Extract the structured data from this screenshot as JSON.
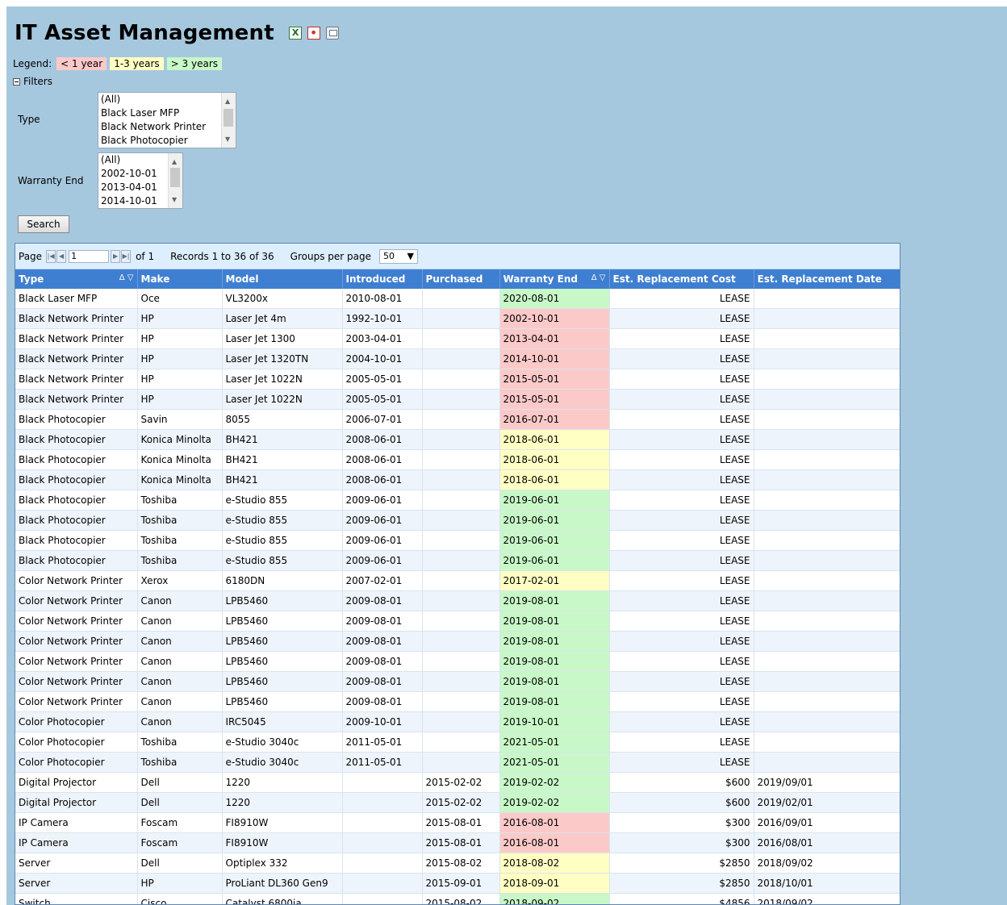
{
  "page": {
    "title": "IT Asset Management"
  },
  "legend": {
    "label": "Legend:",
    "items": [
      {
        "label": "< 1 year",
        "color": "#fcc9c9"
      },
      {
        "label": "1-3 years",
        "color": "#ffffc4"
      },
      {
        "label": "> 3 years",
        "color": "#c8f7c8"
      }
    ]
  },
  "filters": {
    "toggle_label": "Filters",
    "type": {
      "label": "Type",
      "options": [
        "(All)",
        "Black Laser MFP",
        "Black Network Printer",
        "Black Photocopier"
      ]
    },
    "warranty_end": {
      "label": "Warranty End",
      "options": [
        "(All)",
        "2002-10-01",
        "2013-04-01",
        "2014-10-01"
      ]
    },
    "search_label": "Search"
  },
  "pager": {
    "page_label": "Page",
    "page_value": "1",
    "of_label": "of 1",
    "records_label": "Records 1 to 36 of 36",
    "groups_label": "Groups per page",
    "groups_value": "50"
  },
  "table": {
    "columns": [
      "Type",
      "Make",
      "Model",
      "Introduced",
      "Purchased",
      "Warranty End",
      "Est. Replacement Cost",
      "Est. Replacement Date"
    ],
    "rows": [
      [
        "Black Laser MFP",
        "Oce",
        "VL3200x",
        "2010-08-01",
        "",
        "2020-08-01",
        "LEASE",
        "",
        "green"
      ],
      [
        "Black Network Printer",
        "HP",
        "Laser Jet 4m",
        "1992-10-01",
        "",
        "2002-10-01",
        "LEASE",
        "",
        "red"
      ],
      [
        "Black Network Printer",
        "HP",
        "Laser Jet 1300",
        "2003-04-01",
        "",
        "2013-04-01",
        "LEASE",
        "",
        "red"
      ],
      [
        "Black Network Printer",
        "HP",
        "Laser Jet 1320TN",
        "2004-10-01",
        "",
        "2014-10-01",
        "LEASE",
        "",
        "red"
      ],
      [
        "Black Network Printer",
        "HP",
        "Laser Jet 1022N",
        "2005-05-01",
        "",
        "2015-05-01",
        "LEASE",
        "",
        "red"
      ],
      [
        "Black Network Printer",
        "HP",
        "Laser Jet 1022N",
        "2005-05-01",
        "",
        "2015-05-01",
        "LEASE",
        "",
        "red"
      ],
      [
        "Black Photocopier",
        "Savin",
        "8055",
        "2006-07-01",
        "",
        "2016-07-01",
        "LEASE",
        "",
        "red"
      ],
      [
        "Black Photocopier",
        "Konica Minolta",
        "BH421",
        "2008-06-01",
        "",
        "2018-06-01",
        "LEASE",
        "",
        "yellow"
      ],
      [
        "Black Photocopier",
        "Konica Minolta",
        "BH421",
        "2008-06-01",
        "",
        "2018-06-01",
        "LEASE",
        "",
        "yellow"
      ],
      [
        "Black Photocopier",
        "Konica Minolta",
        "BH421",
        "2008-06-01",
        "",
        "2018-06-01",
        "LEASE",
        "",
        "yellow"
      ],
      [
        "Black Photocopier",
        "Toshiba",
        "e-Studio 855",
        "2009-06-01",
        "",
        "2019-06-01",
        "LEASE",
        "",
        "green"
      ],
      [
        "Black Photocopier",
        "Toshiba",
        "e-Studio 855",
        "2009-06-01",
        "",
        "2019-06-01",
        "LEASE",
        "",
        "green"
      ],
      [
        "Black Photocopier",
        "Toshiba",
        "e-Studio 855",
        "2009-06-01",
        "",
        "2019-06-01",
        "LEASE",
        "",
        "green"
      ],
      [
        "Black Photocopier",
        "Toshiba",
        "e-Studio 855",
        "2009-06-01",
        "",
        "2019-06-01",
        "LEASE",
        "",
        "green"
      ],
      [
        "Color Network Printer",
        "Xerox",
        "6180DN",
        "2007-02-01",
        "",
        "2017-02-01",
        "LEASE",
        "",
        "yellow"
      ],
      [
        "Color Network Printer",
        "Canon",
        "LPB5460",
        "2009-08-01",
        "",
        "2019-08-01",
        "LEASE",
        "",
        "green"
      ],
      [
        "Color Network Printer",
        "Canon",
        "LPB5460",
        "2009-08-01",
        "",
        "2019-08-01",
        "LEASE",
        "",
        "green"
      ],
      [
        "Color Network Printer",
        "Canon",
        "LPB5460",
        "2009-08-01",
        "",
        "2019-08-01",
        "LEASE",
        "",
        "green"
      ],
      [
        "Color Network Printer",
        "Canon",
        "LPB5460",
        "2009-08-01",
        "",
        "2019-08-01",
        "LEASE",
        "",
        "green"
      ],
      [
        "Color Network Printer",
        "Canon",
        "LPB5460",
        "2009-08-01",
        "",
        "2019-08-01",
        "LEASE",
        "",
        "green"
      ],
      [
        "Color Network Printer",
        "Canon",
        "LPB5460",
        "2009-08-01",
        "",
        "2019-08-01",
        "LEASE",
        "",
        "green"
      ],
      [
        "Color Photocopier",
        "Canon",
        "IRC5045",
        "2009-10-01",
        "",
        "2019-10-01",
        "LEASE",
        "",
        "green"
      ],
      [
        "Color Photocopier",
        "Toshiba",
        "e-Studio 3040c",
        "2011-05-01",
        "",
        "2021-05-01",
        "LEASE",
        "",
        "green"
      ],
      [
        "Color Photocopier",
        "Toshiba",
        "e-Studio 3040c",
        "2011-05-01",
        "",
        "2021-05-01",
        "LEASE",
        "",
        "green"
      ],
      [
        "Digital Projector",
        "Dell",
        "1220",
        "",
        "2015-02-02",
        "2019-02-02",
        "$600",
        "2019/09/01",
        "green"
      ],
      [
        "Digital Projector",
        "Dell",
        "1220",
        "",
        "2015-02-02",
        "2019-02-02",
        "$600",
        "2019/02/01",
        "green"
      ],
      [
        "IP Camera",
        "Foscam",
        "FI8910W",
        "",
        "2015-08-01",
        "2016-08-01",
        "$300",
        "2016/09/01",
        "red"
      ],
      [
        "IP Camera",
        "Foscam",
        "FI8910W",
        "",
        "2015-08-01",
        "2016-08-01",
        "$300",
        "2016/08/01",
        "red"
      ],
      [
        "Server",
        "Dell",
        "Optiplex 332",
        "",
        "2015-08-02",
        "2018-08-02",
        "$2850",
        "2018/09/02",
        "yellow"
      ],
      [
        "Server",
        "HP",
        "ProLiant DL360 Gen9",
        "",
        "2015-09-01",
        "2018-09-01",
        "$2850",
        "2018/10/01",
        "yellow"
      ],
      [
        "Switch",
        "Cisco",
        "Catalyst 6800ia",
        "",
        "2015-08-02",
        "2018-09-02",
        "$4856",
        "2018/09/02",
        "green"
      ]
    ]
  }
}
